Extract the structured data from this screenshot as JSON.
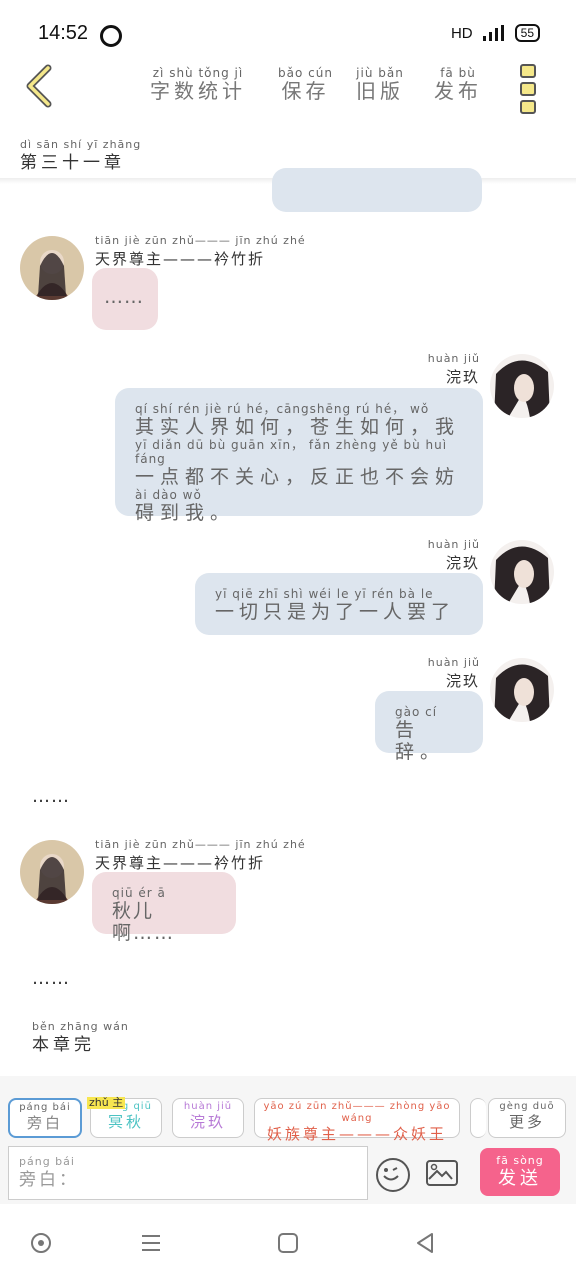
{
  "status": {
    "time": "14:52",
    "network": "HD",
    "battery": "55"
  },
  "header": {
    "tabs": [
      {
        "py": "zì shù tǒng jì",
        "hz": "字数统计"
      },
      {
        "py": "bǎo cún",
        "hz": "保存"
      },
      {
        "py": "jiù bǎn",
        "hz": "旧版"
      },
      {
        "py": "fā bù",
        "hz": "发布"
      }
    ]
  },
  "chapter": {
    "py": "dì sān shí yī zhāng",
    "hz": "第三十一章"
  },
  "messages": [
    {
      "speaker_py": "tiān jiè zūn zhǔ——— jīn zhú zhé",
      "speaker": "天界尊主———衿竹折",
      "text_py": "",
      "text": "……"
    },
    {
      "speaker_py": "huàn jiǔ",
      "speaker": "浣玖",
      "lines": [
        {
          "py": "qí shí rén jiè rú hé，cāngshēng rú hé， wǒ",
          "hz": "其实人界如何，苍生如何，我"
        },
        {
          "py": "yī diǎn dū bù guān xīn， fǎn zhèng yě bù huì fáng",
          "hz": "一点都不关心，反正也不会妨"
        },
        {
          "py": "ài dào wǒ",
          "hz": "碍到我。"
        }
      ]
    },
    {
      "speaker_py": "huàn jiǔ",
      "speaker": "浣玖",
      "text_py": "yī qiē zhī shì wéi le yī rén bà le",
      "text": "一切只是为了一人罢了"
    },
    {
      "speaker_py": "huàn jiǔ",
      "speaker": "浣玖",
      "text_py": "gào cí",
      "text": "告辞。"
    },
    {
      "speaker_py": "tiān jiè zūn zhǔ——— jīn zhú zhé",
      "speaker": "天界尊主———衿竹折",
      "text_py": "qiū ér ā",
      "text": "秋儿啊……"
    }
  ],
  "narration1": "……",
  "narration2": "……",
  "chapter_end": {
    "py": "běn zhāng wán",
    "hz": "本章完"
  },
  "roles": [
    {
      "py": "páng bái",
      "hz": "旁白",
      "color": "#888888"
    },
    {
      "py": "míng qiū",
      "hz": "冥秋",
      "color": "#4cc3c3",
      "tag": "zhǔ 主"
    },
    {
      "py": "huàn jiǔ",
      "hz": "浣玖",
      "color": "#b77ad6"
    },
    {
      "py": "yāo zú zūn zhǔ——— zhòng yāo wáng",
      "hz": "妖族尊主———众妖王",
      "color": "#e0604a"
    },
    {
      "py": "gèng duō",
      "hz": "更多",
      "color": "#666666"
    }
  ],
  "input": {
    "py": "páng bái",
    "hz": "旁白："
  },
  "send": {
    "py": "fā sòng",
    "hz": "发送"
  }
}
